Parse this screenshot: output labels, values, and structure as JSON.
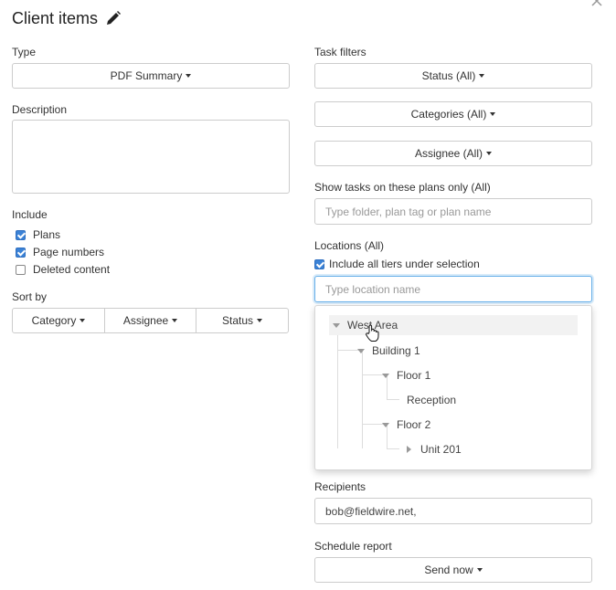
{
  "header": {
    "title": "Client items",
    "edit_icon": "pencil-icon",
    "close_icon": "close-icon"
  },
  "left": {
    "type": {
      "label": "Type",
      "value": "PDF Summary"
    },
    "description": {
      "label": "Description",
      "value": ""
    },
    "include": {
      "label": "Include",
      "items": [
        {
          "label": "Plans",
          "checked": true
        },
        {
          "label": "Page numbers",
          "checked": true
        },
        {
          "label": "Deleted content",
          "checked": false
        }
      ]
    },
    "sort_by": {
      "label": "Sort by",
      "options": [
        "Category",
        "Assignee",
        "Status"
      ]
    }
  },
  "right": {
    "task_filters": {
      "label": "Task filters",
      "status": "Status (All)",
      "categories": "Categories (All)",
      "assignee": "Assignee (All)"
    },
    "show_tasks": {
      "label": "Show tasks on these plans only (All)",
      "placeholder": "Type folder, plan tag or plan name"
    },
    "locations": {
      "label": "Locations (All)",
      "include_tiers": {
        "label": "Include all tiers under selection",
        "checked": true
      },
      "placeholder": "Type location name",
      "tree": [
        {
          "label": "West Area",
          "state": "expanded"
        },
        {
          "label": "Building 1",
          "state": "expanded"
        },
        {
          "label": "Floor 1",
          "state": "expanded"
        },
        {
          "label": "Reception",
          "state": "leaf"
        },
        {
          "label": "Floor 2",
          "state": "expanded"
        },
        {
          "label": "Unit 201",
          "state": "collapsed"
        }
      ]
    },
    "recipients": {
      "label": "Recipients",
      "value": "bob@fieldwire.net,"
    },
    "schedule": {
      "label": "Schedule report",
      "value": "Send now"
    }
  },
  "colors": {
    "checkbox": "#3b82d6",
    "focus_border": "#66afe9",
    "hover_row": "#f2f2f2"
  }
}
